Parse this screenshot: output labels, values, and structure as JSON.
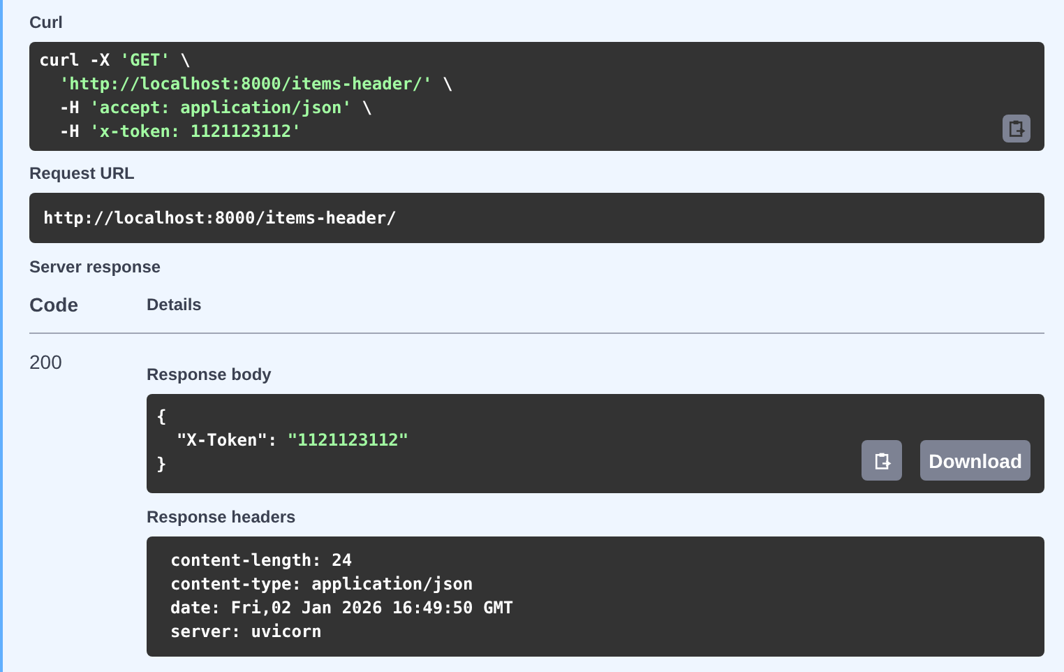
{
  "curl": {
    "label": "Curl",
    "lines": [
      {
        "indented": false,
        "parts": [
          {
            "kind": "plain",
            "text": "curl -X "
          },
          {
            "kind": "string",
            "text": "'GET'"
          },
          {
            "kind": "plain",
            "text": " \\"
          }
        ]
      },
      {
        "indented": true,
        "parts": [
          {
            "kind": "string",
            "text": "'http://localhost:8000/items-header/'"
          },
          {
            "kind": "plain",
            "text": " \\"
          }
        ]
      },
      {
        "indented": true,
        "parts": [
          {
            "kind": "plain",
            "text": "-H "
          },
          {
            "kind": "string",
            "text": "'accept: application/json'"
          },
          {
            "kind": "plain",
            "text": " \\"
          }
        ]
      },
      {
        "indented": true,
        "parts": [
          {
            "kind": "plain",
            "text": "-H "
          },
          {
            "kind": "string",
            "text": "'x-token: 1121123112'"
          }
        ]
      }
    ]
  },
  "request_url": {
    "label": "Request URL",
    "value": "http://localhost:8000/items-header/"
  },
  "server_response": {
    "label": "Server response",
    "columns": [
      "Code",
      "Details"
    ],
    "code": "200",
    "body": {
      "label": "Response body",
      "lines": [
        [
          {
            "kind": "plain",
            "text": "{"
          }
        ],
        [
          {
            "kind": "plain",
            "text": "  \"X-Token\": "
          },
          {
            "kind": "string",
            "text": "\"1121123112\""
          }
        ],
        [
          {
            "kind": "plain",
            "text": "}"
          }
        ]
      ],
      "download": "Download"
    },
    "headers": {
      "label": "Response headers",
      "lines": [
        "content-length: 24",
        "content-type: application/json",
        "date: Fri,02 Jan 2026 16:49:50 GMT",
        "server: uvicorn"
      ]
    }
  }
}
